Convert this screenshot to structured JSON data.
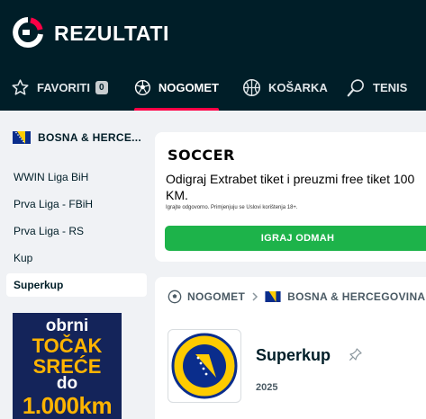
{
  "brand": {
    "name": "REZULTATI",
    "accent": "#ff0046",
    "topbar_bg": "#001e28"
  },
  "nav": {
    "favorites": {
      "label": "FAVORITI",
      "count": "0",
      "icon": "star-icon"
    },
    "items": [
      {
        "label": "NOGOMET",
        "icon": "soccer-ball-icon",
        "active": true
      },
      {
        "label": "KOŠARKA",
        "icon": "basketball-icon",
        "active": false
      },
      {
        "label": "TENIS",
        "icon": "tennis-racket-icon",
        "active": false
      }
    ]
  },
  "sidebar": {
    "country": "BOSNA & HERCE...",
    "leagues": [
      {
        "label": "WWIN Liga BiH",
        "active": false
      },
      {
        "label": "Prva Liga - FBiH",
        "active": false
      },
      {
        "label": "Prva Liga - RS",
        "active": false
      },
      {
        "label": "Kup",
        "active": false
      },
      {
        "label": "Superkup",
        "active": true
      }
    ],
    "promo": {
      "line1": "obrni",
      "line2": "TOČAK",
      "line3": "SREĆE",
      "line4": "do",
      "line5": "1.000km"
    }
  },
  "ad": {
    "brand": "SOCCER",
    "title": "Odigraj Extrabet tiket i preuzmi free tiket 100 KM.",
    "disclaimer": "Igrajte odgovorno. Primjenjuju se Uslovi korištenja 18+.",
    "button": "IGRAJ ODMAH",
    "button_color": "#1db34a"
  },
  "league": {
    "breadcrumb": [
      "NOGOMET",
      "BOSNA & HERCEGOVINA"
    ],
    "name": "Superkup",
    "season": "2025",
    "logo": "football-federation-bih-logo"
  }
}
